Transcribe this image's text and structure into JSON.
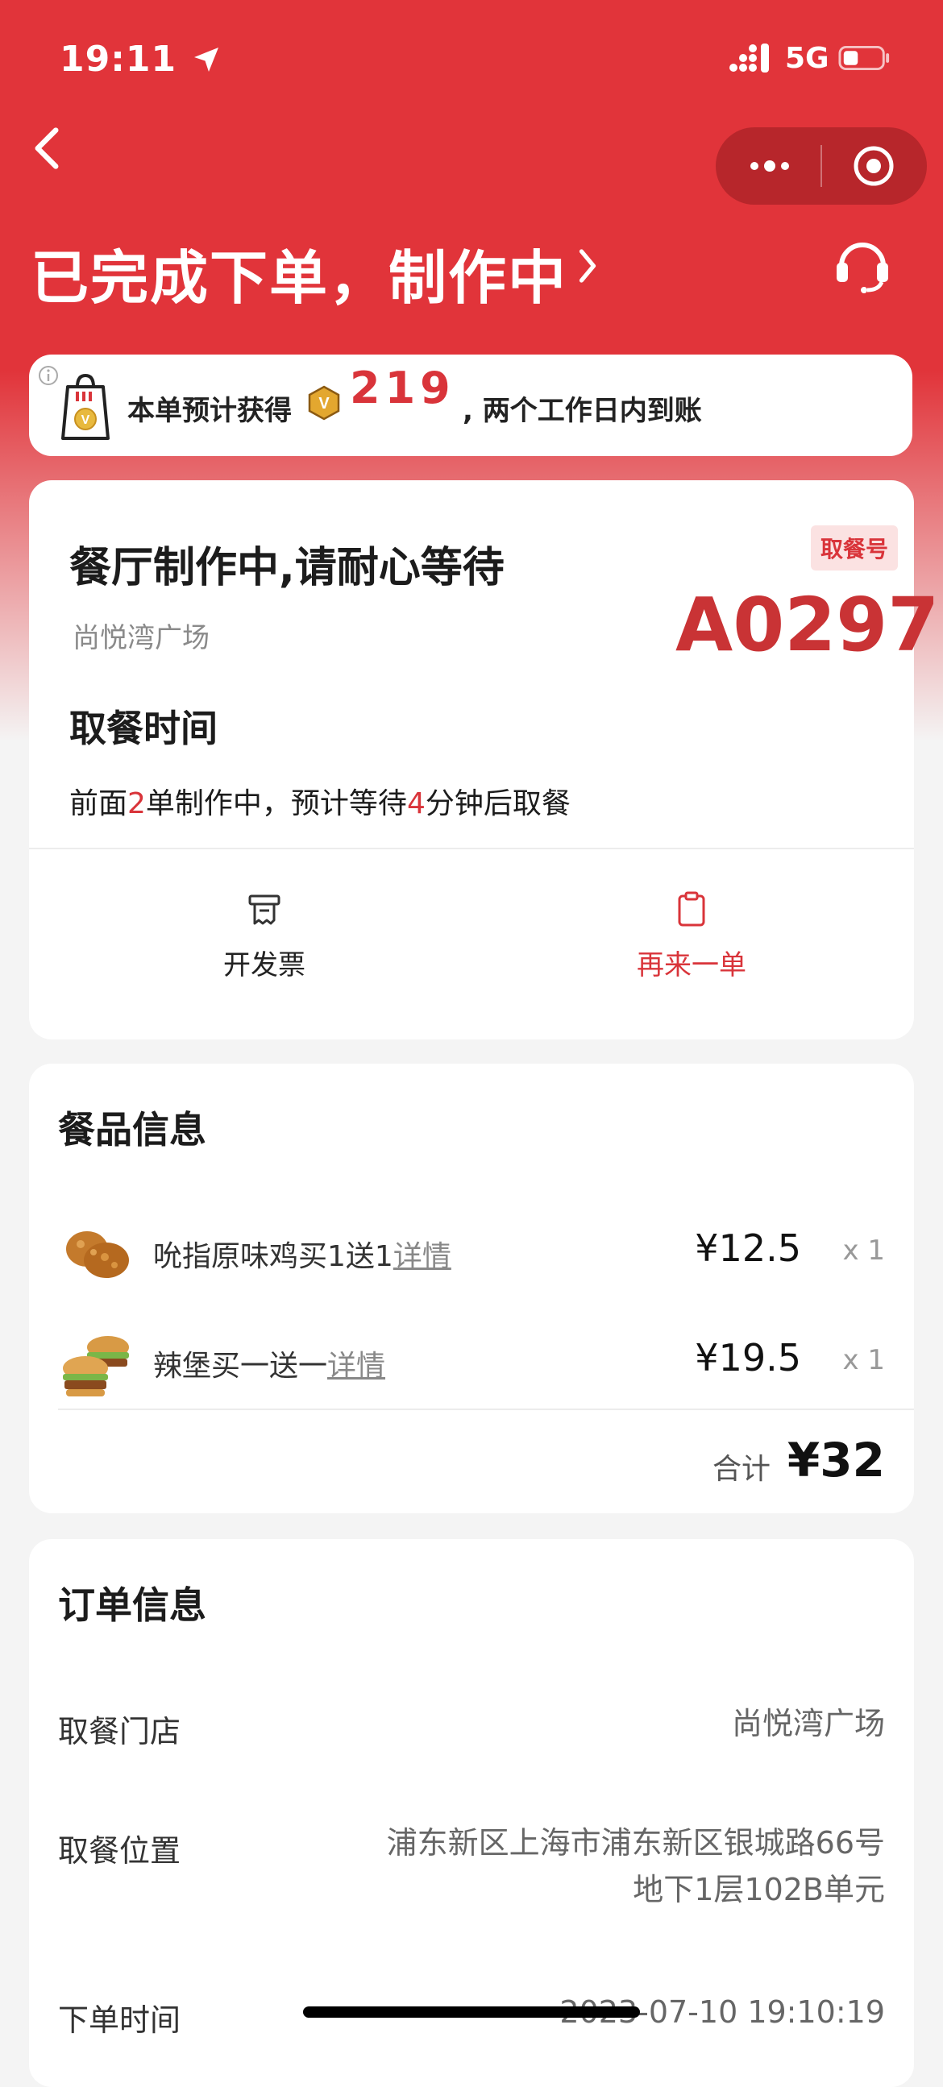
{
  "status_bar": {
    "time": "19:11",
    "network": "5G"
  },
  "header": {
    "title": "已完成下单，制作中"
  },
  "points_banner": {
    "prefix": "本单预计获得",
    "points": "219",
    "suffix": ", 两个工作日内到账"
  },
  "order_status": {
    "title": "餐厅制作中,请耐心等待",
    "store": "尚悦湾广场",
    "pickup_badge": "取餐号",
    "pickup_number": "A0297",
    "pickup_time_label": "取餐时间",
    "queue": {
      "pre": "前面",
      "orders_ahead": "2",
      "mid": "单制作中，预计等待",
      "minutes": "4",
      "post": "分钟后取餐"
    },
    "actions": {
      "invoice": "开发票",
      "reorder": "再来一单"
    }
  },
  "food_info": {
    "title": "餐品信息",
    "items": [
      {
        "name": "吮指原味鸡买1送1",
        "detail": "详情",
        "price": "¥12.5",
        "qty": "x 1"
      },
      {
        "name": "辣堡买一送一",
        "detail": "详情",
        "price": "¥19.5",
        "qty": "x 1"
      }
    ],
    "total_label": "合计",
    "total": "¥32"
  },
  "order_info": {
    "title": "订单信息",
    "rows": [
      {
        "label": "取餐门店",
        "value": "尚悦湾广场"
      },
      {
        "label": "取餐位置",
        "value_line1": "浦东新区上海市浦东新区银城路66号",
        "value_line2": "地下1层102B单元"
      },
      {
        "label": "下单时间",
        "value": "2023-07-10 19:10:19"
      }
    ]
  },
  "colors": {
    "brand_red": "#e1343a",
    "accent_red": "#d9343a"
  }
}
